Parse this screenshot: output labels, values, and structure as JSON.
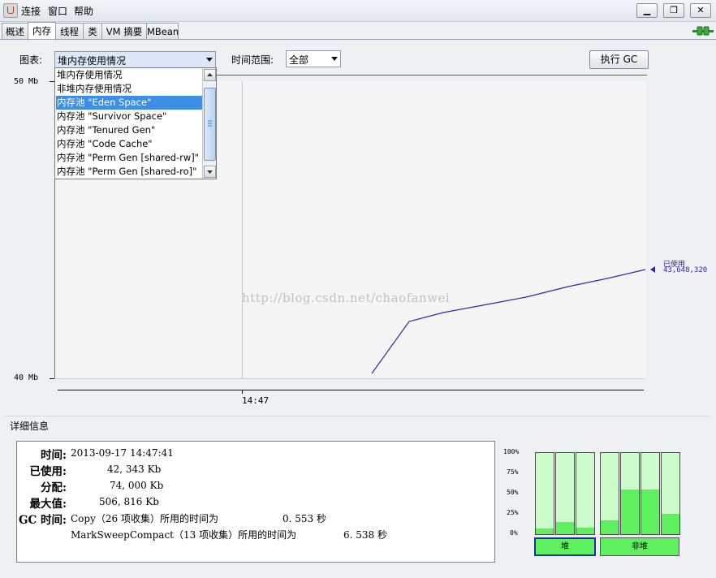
{
  "menu": [
    "连接",
    "窗口",
    "帮助"
  ],
  "window_buttons": {
    "minimize": "▁",
    "restore": "❐",
    "close": "✕"
  },
  "tabs": [
    "概述",
    "内存",
    "线程",
    "类",
    "VM 摘要",
    "MBean"
  ],
  "active_tab": "内存",
  "toolbar": {
    "chart_label": "图表:",
    "chart_value": "堆内存使用情况",
    "time_range_label": "时间范围:",
    "time_range_value": "全部",
    "gc_button": "执行 GC"
  },
  "dropdown": {
    "items": [
      "堆内存使用情况",
      "非堆内存使用情况",
      "内存池 \"Eden Space\"",
      "内存池 \"Survivor Space\"",
      "内存池 \"Tenured Gen\"",
      "内存池 \"Code Cache\"",
      "内存池 \"Perm Gen [shared-rw]\"",
      "内存池 \"Perm Gen [shared-ro]\""
    ],
    "highlighted": "内存池 \"Eden Space\""
  },
  "chart_data": {
    "type": "line",
    "y_tick_labels": [
      "50 Mb",
      "40 Mb"
    ],
    "x_tick_labels": [
      "14:47"
    ],
    "series": [
      {
        "name": "已使用",
        "value_label": "43,648,320",
        "color": "#2a2ab5"
      }
    ]
  },
  "watermark": "http://blog.csdn.net/chaofanwei",
  "details": {
    "title": "详细信息",
    "labels": {
      "time": "时间:",
      "used": "已使用:",
      "committed": "分配:",
      "max": "最大值:",
      "gc": "GC 时间:"
    },
    "time": "2013-09-17 14:47:41",
    "used": "42, 343 Kb",
    "committed": "74, 000 Kb",
    "max": "506, 816 Kb",
    "gc": [
      {
        "text": "Copy（26 项收集）所用的时间为",
        "value": "0. 553 秒"
      },
      {
        "text": "MarkSweepCompact（13 项收集）所用的时间为",
        "value": "6. 538 秒"
      }
    ]
  },
  "pool_bars": {
    "percent_labels": [
      "100%",
      "75%",
      "50%",
      "25%",
      "0%"
    ],
    "heap_fills": [
      0.07,
      0.15,
      0.08
    ],
    "non_heap_fills": [
      0.17,
      0.55,
      0.55,
      0.25
    ],
    "heap_label": "堆",
    "non_heap_label": "非堆",
    "fill_color": "#5ef05e",
    "empty_color": "#ccfccc"
  }
}
